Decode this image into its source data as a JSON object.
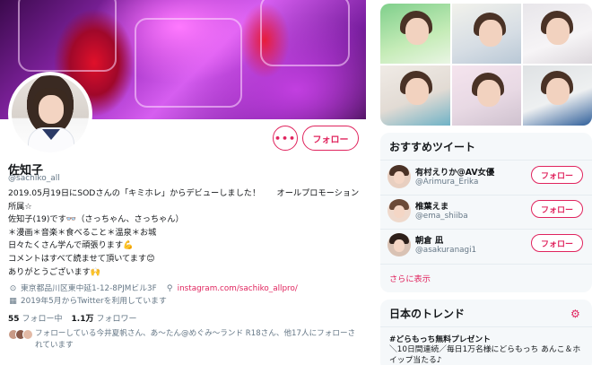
{
  "profile": {
    "name": "佐知子",
    "handle": "@sachiko_all",
    "bio": "2019.05月19日にSODさんの「キミホレ」からデビューしました！　　オールプロモーション所属☆\n佐知子(19)です👓（さっちゃん、さっちゃん）\n＊漫画＊音楽＊食べること＊温泉＊お城\n日々たくさん学んで頑張ります💪\nコメントはすべて読ませて頂いてます😊\nありがとうございます🙌",
    "location": "東京都品川区東中延1-12-8PJMビル3F",
    "website": "instagram.com/sachiko_allpro/",
    "joined": "2019年5月からTwitterを利用しています",
    "following_count": "55",
    "following_label": "フォロー中",
    "followers_count": "1.1万",
    "followers_label": "フォロワー",
    "mutual_text": "フォローしている今井夏帆さん、あ～たん@めぐみ～ランド R18さん、他17人にフォローされています",
    "more_button": "•••",
    "follow_button": "フォロー"
  },
  "icons": {
    "location": "location-pin-icon",
    "link": "link-icon",
    "calendar": "calendar-icon",
    "more": "more-icon",
    "settings": "gear-icon"
  },
  "recommend": {
    "title": "おすすめツイート",
    "items": [
      {
        "name": "有村えりか@AV女優",
        "handle": "@Arimura_Erika",
        "button": "フォロー"
      },
      {
        "name": "椎葉えま",
        "handle": "@ema_shiiba",
        "button": "フォロー"
      },
      {
        "name": "朝倉 凪",
        "handle": "@asakuranagi1",
        "button": "フォロー"
      }
    ],
    "more": "さらに表示"
  },
  "trends": {
    "title": "日本のトレンド",
    "items": [
      {
        "tag": "#どらもっち無料プレゼント",
        "desc": "＼10日間連続／毎日1万名様にどらもっち あんこ＆ホイップ当たる♪"
      }
    ]
  },
  "colors": {
    "accent": "#e0245e",
    "secondary_text": "#657786",
    "card_bg": "#f5f8fa"
  }
}
